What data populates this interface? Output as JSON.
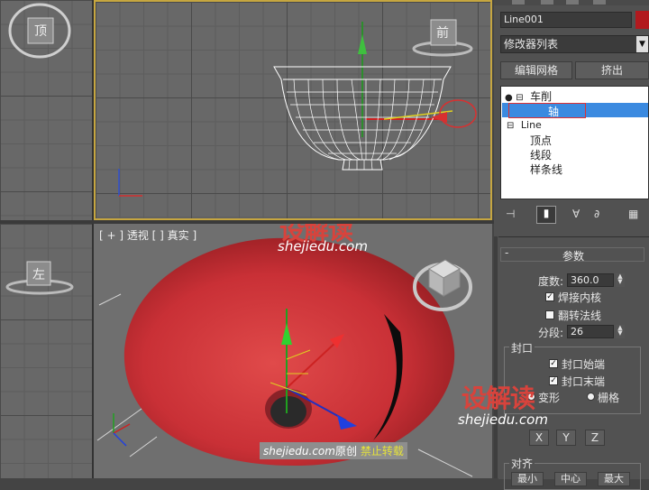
{
  "viewports": {
    "top_label": "[ + ] 透视 [ ] 真实 ]",
    "top_left_cube_label": "顶",
    "front_cube_label": "前",
    "left_cube_label": "左"
  },
  "command_panel": {
    "object_name": "Line001",
    "object_color": "#b2191e",
    "modifier_list": "修改器列表",
    "btn_edit_mesh": "编辑网格",
    "btn_extrude": "挤出",
    "stack": {
      "lathe": "车削",
      "axis": "轴",
      "line": "Line",
      "vertex": "顶点",
      "segment": "线段",
      "spline": "样条线"
    },
    "rollout_title": "参数",
    "degrees_label": "度数:",
    "degrees_value": "360.0",
    "weld_core_label": "焊接内核",
    "weld_core_checked": true,
    "flip_normals_label": "翻转法线",
    "flip_normals_checked": false,
    "segments_label": "分段:",
    "segments_value": "26",
    "capping_group": "封口",
    "cap_start_label": "封口始端",
    "cap_start_checked": true,
    "cap_end_label": "封口末端",
    "cap_end_checked": true,
    "morph_label": "变形",
    "grid_label": "栅格",
    "direction_x": "X",
    "direction_y": "Y",
    "direction_z": "Z",
    "align_group": "对齐",
    "align_min": "最小",
    "align_center": "中心",
    "align_max": "最大"
  },
  "watermark": {
    "logo_text": "设解读",
    "url": "shejiedu.com",
    "footer_site": "shejiedu.com",
    "footer_original": "原创",
    "footer_forbid": "禁止转载"
  },
  "colors": {
    "accent_red": "#d8433c",
    "selection_blue": "#3b8ae0",
    "viewport_border_yellow": "#c6a640"
  }
}
